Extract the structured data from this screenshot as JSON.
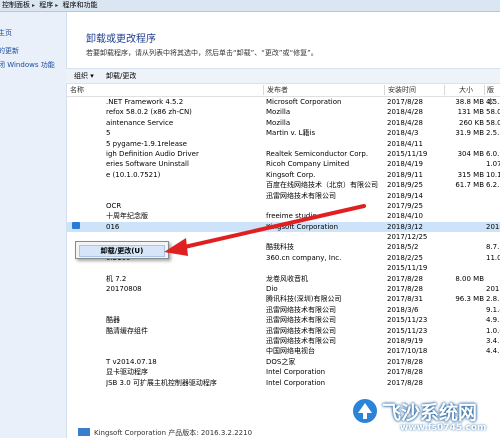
{
  "address_bar": {
    "segments": [
      "控制面板",
      "程序",
      "程序和功能"
    ]
  },
  "left_pane": {
    "links": [
      "主页",
      "的更新",
      "闭 Windows 功能"
    ]
  },
  "main": {
    "title": "卸载或更改程序",
    "description": "若要卸载程序，请从列表中将其选中，然后单击“卸载”、“更改”或“修复”。"
  },
  "toolbar": {
    "organize": "组织 ▾",
    "uninstall_change": "卸载/更改"
  },
  "columns": {
    "name": "名称",
    "publisher": "发布者",
    "installed_on": "安装时间",
    "size": "大小",
    "version": "版本"
  },
  "rows": [
    {
      "name": ".NET Framework 4.5.2",
      "publisher": "Microsoft Corporation",
      "date": "2017/8/28",
      "size": "38.8 MB",
      "version": "4.5.5"
    },
    {
      "name": "refox 58.0.2 (x86 zh-CN)",
      "publisher": "Mozilla",
      "date": "2018/4/28",
      "size": "131 MB",
      "version": "58.0"
    },
    {
      "name": "aintenance Service",
      "publisher": "Mozilla",
      "date": "2018/4/28",
      "size": "260 KB",
      "version": "58.0"
    },
    {
      "name": "5",
      "publisher": "Martin v. L籍is",
      "date": "2018/4/3",
      "size": "31.9 MB",
      "version": "2.5."
    },
    {
      "name": "5 pygame-1.9.1release",
      "publisher": "",
      "date": "2018/4/11",
      "size": "",
      "version": ""
    },
    {
      "name": "igh Definition Audio Driver",
      "publisher": "Realtek Semiconductor Corp.",
      "date": "2015/11/19",
      "size": "304 MB",
      "version": "6.0."
    },
    {
      "name": "eries Software Uninstall",
      "publisher": "Ricoh Company Limited",
      "date": "2018/4/19",
      "size": "",
      "version": "1.07"
    },
    {
      "name": "e (10.1.0.7521)",
      "publisher": "Kingsoft Corp.",
      "date": "2018/9/11",
      "size": "315 MB",
      "version": "10.1"
    },
    {
      "name": "",
      "publisher": "百度在线网络技术（北京）有限公司",
      "date": "2018/9/25",
      "size": "61.7 MB",
      "version": "6.2."
    },
    {
      "name": "",
      "publisher": "迅雷网络技术有限公司",
      "date": "2018/9/14",
      "size": "",
      "version": ""
    },
    {
      "name": "OCR",
      "publisher": "",
      "date": "2017/9/25",
      "size": "",
      "version": ""
    },
    {
      "name": "十周年纪念版",
      "publisher": "freeime studio",
      "date": "2018/4/10",
      "size": "",
      "version": ""
    },
    {
      "name": "016",
      "publisher": "Kingsoft Corporation",
      "date": "2018/3/12",
      "size": "",
      "version": "2016"
    },
    {
      "name": "",
      "publisher": "",
      "date": "2017/12/25",
      "size": "",
      "version": ""
    },
    {
      "name": "",
      "publisher": "酷我科技",
      "date": "2018/5/2",
      "size": "",
      "version": "8.7."
    },
    {
      "name": "0.2100",
      "publisher": "360.cn company, Inc.",
      "date": "2018/2/25",
      "size": "",
      "version": "11.0"
    },
    {
      "name": "",
      "publisher": "",
      "date": "2015/11/19",
      "size": "",
      "version": ""
    },
    {
      "name": "机 7.2",
      "publisher": "龙卷风收音机",
      "date": "2017/8/28",
      "size": "8.00 MB",
      "version": ""
    },
    {
      "name": "20170808",
      "publisher": "Dio",
      "date": "2017/8/28",
      "size": "",
      "version": "2017"
    },
    {
      "name": "",
      "publisher": "腾讯科技(深圳)有限公司",
      "date": "2017/8/31",
      "size": "96.3 MB",
      "version": "2.8."
    },
    {
      "name": "",
      "publisher": "迅雷网络技术有限公司",
      "date": "2018/3/6",
      "size": "",
      "version": "9.1.4"
    },
    {
      "name": "酷器",
      "publisher": "迅雷网络技术有限公司",
      "date": "2015/11/23",
      "size": "",
      "version": "4.9.1"
    },
    {
      "name": "酷清缓存组件",
      "publisher": "迅雷网络技术有限公司",
      "date": "2015/11/23",
      "size": "",
      "version": "1.0.0"
    },
    {
      "name": "",
      "publisher": "迅雷网络技术有限公司",
      "date": "2018/9/19",
      "size": "",
      "version": "3.4.1"
    },
    {
      "name": "",
      "publisher": "中国网络电视台",
      "date": "2017/10/18",
      "size": "",
      "version": "4.4.1"
    },
    {
      "name": "T v2014.07.18",
      "publisher": "DOS之家",
      "date": "2017/8/28",
      "size": "",
      "version": ""
    },
    {
      "name": "显卡驱动程序",
      "publisher": "Intel Corporation",
      "date": "2017/8/28",
      "size": "",
      "version": ""
    },
    {
      "name": "JSB 3.0 可扩展主机控制器驱动程序",
      "publisher": "Intel Corporation",
      "date": "2017/8/28",
      "size": "",
      "version": ""
    }
  ],
  "selected_row_index": 12,
  "context_menu": {
    "item": "卸载/更改(U)"
  },
  "bottom_status": {
    "text": "Kingsoft Corporation  产品版本: 2016.3.2.2210"
  },
  "watermark": {
    "title": "飞沙系统网",
    "url": "www.fs0745.com"
  },
  "colors": {
    "link": "#1a4a9c",
    "title": "#1e3d8f",
    "selection": "#cde3f9",
    "arrow": "#e02020"
  }
}
